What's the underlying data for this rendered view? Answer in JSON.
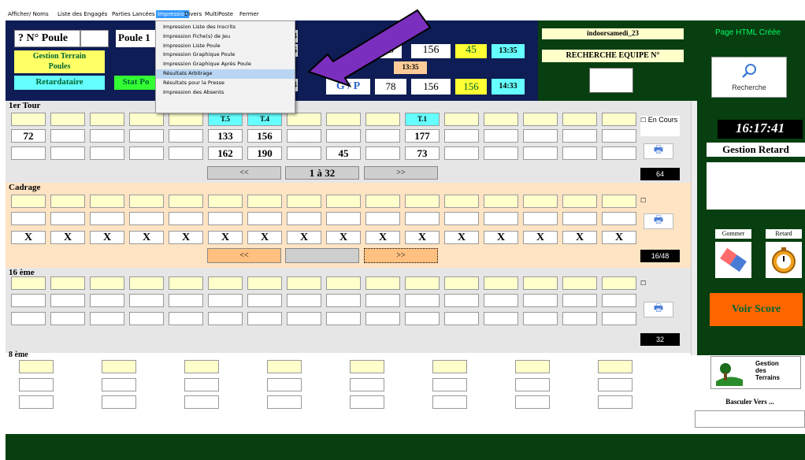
{
  "menubar": {
    "items": [
      {
        "label": "Afficher/ Noms",
        "active": false
      },
      {
        "label": "Liste des Engagés",
        "active": false
      },
      {
        "label": "Parties Lancées",
        "active": false
      },
      {
        "label": "Impression",
        "active": true
      },
      {
        "label": "Divers",
        "active": false
      },
      {
        "label": "MultiPoste",
        "active": false
      },
      {
        "label": "Fermer",
        "active": false
      }
    ]
  },
  "impression_menu": {
    "items": [
      "Impression Liste des Inscrits",
      "Impression Fiche(s) de Jeu",
      "Impression Liste Poule",
      "Impression Graphique Poule",
      "Impression Graphique Après Poule",
      "Résultats Arbitrage",
      "Résultats pour la Presse",
      "Impression des Absents"
    ],
    "highlighted": "Résultats Arbitrage"
  },
  "header": {
    "poule_label": "? N° Poule",
    "poule_value": "Poule 1",
    "gestion_terrain": "Gestion Terrain",
    "poules": "Poules",
    "retardataire": "Retardataire",
    "stat_po": "Stat Po",
    "score_row1": [
      "45",
      "156",
      "45",
      "13:35"
    ],
    "time_mid": "13:35",
    "gp_label": "G / P",
    "score_row2": [
      "78",
      "156",
      "156",
      "14:33"
    ],
    "obscured_1": "3",
    "obscured_2": "6",
    "obscured_3": "3"
  },
  "right": {
    "event_name": "indoorsamedi_23",
    "recherche_equipe": "RECHERCHE EQUIPE N°",
    "page_html": "Page HTML Créée",
    "recherche": "Recherche",
    "clock": "16:17:41",
    "gestion_retard": "Gestion Retard",
    "gommer": "Gommer",
    "retard": "Retard",
    "voir_score": "Voir Score",
    "gestion_terrains": "Gestion des Terrains",
    "basculer": "Basculer Vers ..."
  },
  "tour1": {
    "title": "1er Tour",
    "row1": [
      "",
      "",
      "",
      "",
      "",
      "T.5",
      "T.4",
      "",
      "",
      "",
      "T.1",
      "",
      "",
      "",
      "",
      ""
    ],
    "row2": [
      "72",
      "",
      "",
      "",
      "",
      "133",
      "156",
      "",
      "",
      "",
      "177",
      "",
      "",
      "",
      "",
      ""
    ],
    "row3": [
      "",
      "",
      "",
      "",
      "",
      "162",
      "190",
      "",
      "45",
      "",
      "73",
      "",
      "",
      "",
      "",
      ""
    ],
    "en_cours": "En Cours",
    "prev": "<<",
    "range": "1 à 32",
    "next": ">>",
    "count": "64"
  },
  "cadrage": {
    "title": "Cadrage",
    "row3": [
      "X",
      "X",
      "X",
      "X",
      "X",
      "X",
      "X",
      "X",
      "X",
      "X",
      "X",
      "X",
      "X",
      "X",
      "X",
      "X"
    ],
    "prev": "<<",
    "next": ">>",
    "count": "16/48"
  },
  "seizieme": {
    "title": "16 ème",
    "count": "32"
  },
  "huitieme": {
    "title": "8 ème"
  }
}
